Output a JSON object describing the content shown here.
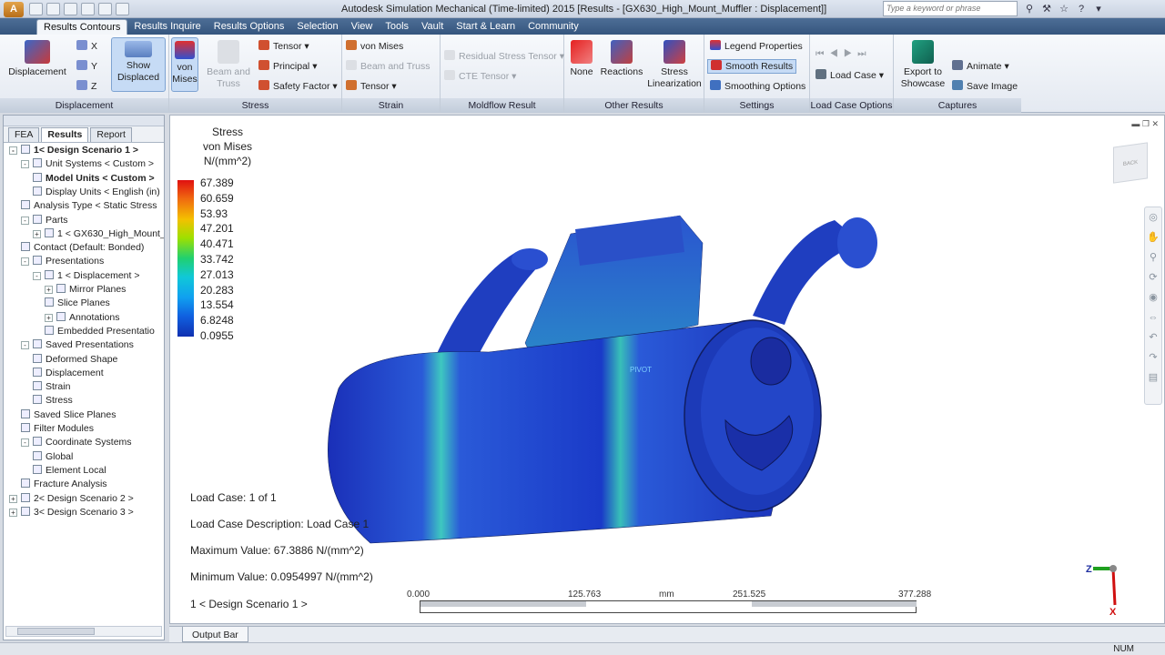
{
  "app_title": "Autodesk Simulation Mechanical (Time-limited) 2015    [Results - [GX630_High_Mount_Muffler : Displacement]]",
  "search_placeholder": "Type a keyword or phrase",
  "tabs": [
    "Results Contours",
    "Results Inquire",
    "Results Options",
    "Selection",
    "View",
    "Tools",
    "Vault",
    "Start & Learn",
    "Community"
  ],
  "ribbon": {
    "displacement": {
      "big": "Displacement",
      "x": "X",
      "y": "Y",
      "z": "Z",
      "show_displaced": "Show Displaced",
      "label": "Displacement"
    },
    "stress": {
      "von_mises": "von Mises",
      "beam_truss": "Beam and Truss",
      "tensor": "Tensor",
      "principal": "Principal",
      "safety": "Safety Factor",
      "label": "Stress"
    },
    "strain": {
      "von_mises": "von Mises",
      "beam_truss": "Beam and Truss",
      "tensor": "Tensor",
      "label": "Strain"
    },
    "moldflow": {
      "residual": "Residual Stress Tensor",
      "cte": "CTE Tensor",
      "label": "Moldflow Result"
    },
    "other": {
      "none": "None",
      "reactions": "Reactions",
      "stress_lin": "Stress Linearization",
      "label": "Other Results"
    },
    "settings": {
      "legend": "Legend Properties",
      "smooth": "Smooth Results",
      "smoothing": "Smoothing Options",
      "label": "Settings"
    },
    "loadcase": {
      "load_case": "Load Case",
      "label": "Load Case Options"
    },
    "captures": {
      "export": "Export to Showcase",
      "animate": "Animate",
      "save_image": "Save Image",
      "label": "Captures"
    }
  },
  "browser_tabs": [
    "FEA",
    "Results",
    "Report"
  ],
  "tree": [
    {
      "label": "1< Design Scenario 1 >",
      "indent": 0,
      "bold": true,
      "expander": "-"
    },
    {
      "label": "Unit Systems < Custom >",
      "indent": 1,
      "expander": "-"
    },
    {
      "label": "Model Units < Custom >",
      "indent": 2,
      "bold": true
    },
    {
      "label": "Display Units < English (in)",
      "indent": 2
    },
    {
      "label": "Analysis Type < Static Stress",
      "indent": 1
    },
    {
      "label": "Parts",
      "indent": 1,
      "expander": "-"
    },
    {
      "label": "1 < GX630_High_Mount_M",
      "indent": 2,
      "expander": "+"
    },
    {
      "label": "Contact (Default: Bonded)",
      "indent": 1
    },
    {
      "label": "Presentations",
      "indent": 1,
      "expander": "-"
    },
    {
      "label": "1 < Displacement >",
      "indent": 2,
      "expander": "-"
    },
    {
      "label": "Mirror Planes",
      "indent": 3,
      "expander": "+"
    },
    {
      "label": "Slice Planes",
      "indent": 3
    },
    {
      "label": "Annotations",
      "indent": 3,
      "expander": "+"
    },
    {
      "label": "Embedded Presentatio",
      "indent": 3
    },
    {
      "label": "Saved Presentations",
      "indent": 1,
      "expander": "-"
    },
    {
      "label": "Deformed Shape",
      "indent": 2
    },
    {
      "label": "Displacement",
      "indent": 2
    },
    {
      "label": "Strain",
      "indent": 2
    },
    {
      "label": "Stress",
      "indent": 2
    },
    {
      "label": "Saved Slice Planes",
      "indent": 1
    },
    {
      "label": "Filter Modules",
      "indent": 1
    },
    {
      "label": "Coordinate Systems",
      "indent": 1,
      "expander": "-"
    },
    {
      "label": "Global",
      "indent": 2
    },
    {
      "label": "Element Local",
      "indent": 2
    },
    {
      "label": "Fracture Analysis",
      "indent": 1
    },
    {
      "label": "2< Design Scenario 2 >",
      "indent": 0,
      "expander": "+"
    },
    {
      "label": "3< Design Scenario 3 >",
      "indent": 0,
      "expander": "+"
    }
  ],
  "legend": {
    "title1": "Stress",
    "title2": "von Mises",
    "unit": "N/(mm^2)",
    "ticks": [
      "67.389",
      "60.659",
      "53.93",
      "47.201",
      "40.471",
      "33.742",
      "27.013",
      "20.283",
      "13.554",
      "6.8248",
      "0.0955"
    ],
    "colors": [
      "#e01010",
      "#1030b0"
    ]
  },
  "info": {
    "load_case": "Load Case:  1 of 1",
    "description": "Load Case Description:  Load Case 1",
    "max": "Maximum Value: 67.3886 N/(mm^2)",
    "min": "Minimum Value: 0.0954997 N/(mm^2)",
    "scenario": "1 < Design Scenario 1 >"
  },
  "scale": {
    "labels": [
      "0.000",
      "125.763",
      "mm",
      "251.525",
      "377.288"
    ]
  },
  "pivot": "PIVOT",
  "output_bar": "Output Bar",
  "status": "NUM"
}
